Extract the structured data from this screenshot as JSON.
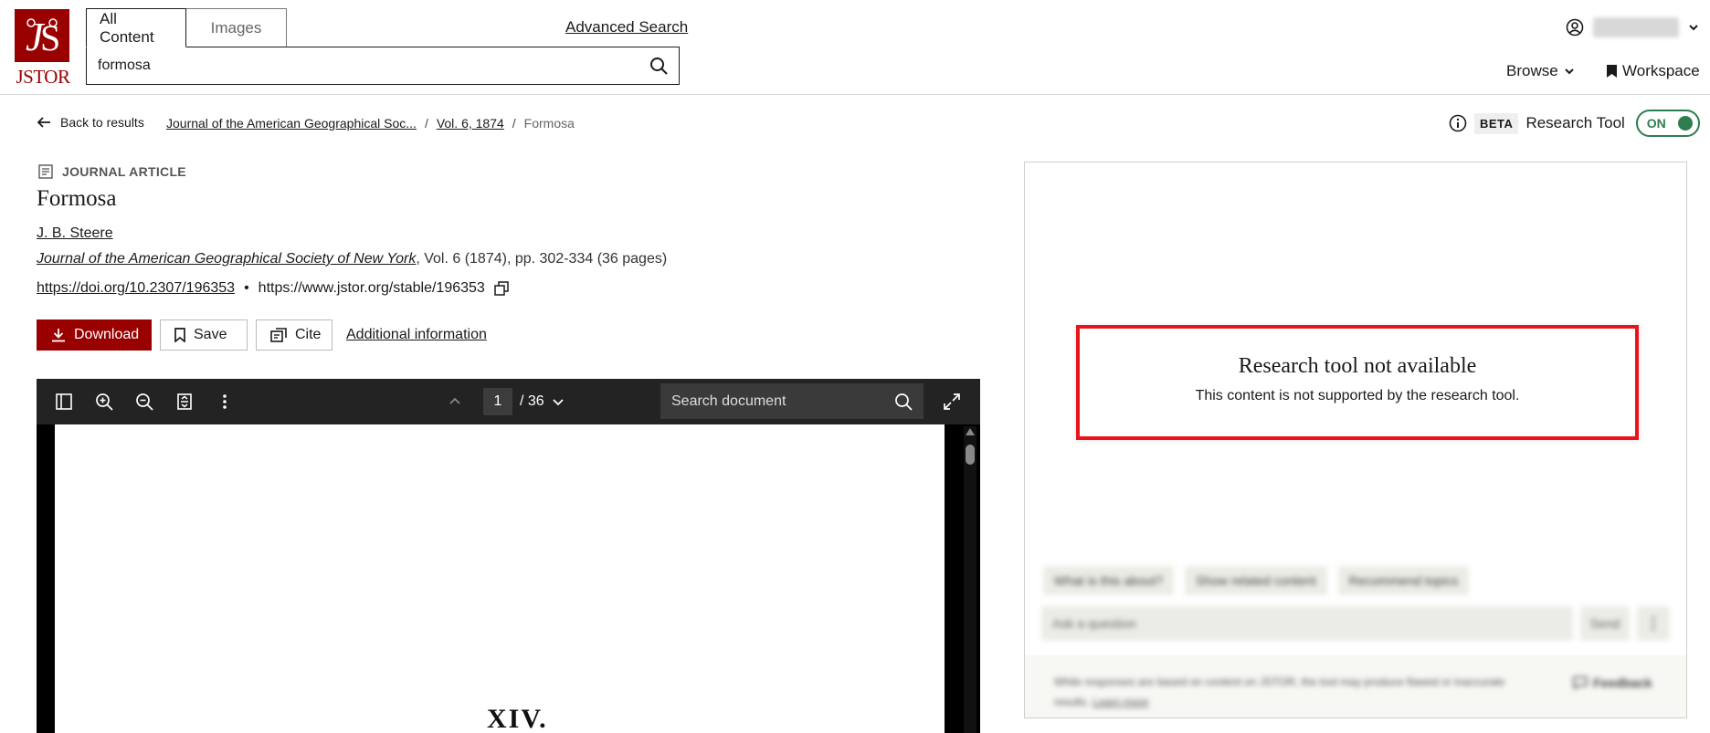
{
  "header": {
    "logo_text": "JSTOR",
    "tabs": [
      "All Content",
      "Images"
    ],
    "search_value": "formosa",
    "advanced_search": "Advanced Search",
    "browse": "Browse",
    "workspace": "Workspace"
  },
  "nav": {
    "back": "Back to results",
    "breadcrumbs": [
      "Journal of the American Geographical Soc...",
      "Vol. 6, 1874"
    ],
    "breadcrumb_current": "Formosa",
    "sep": "/"
  },
  "research_toggle": {
    "badge": "BETA",
    "label": "Research Tool",
    "state": "ON",
    "accent": "#2e7d4f"
  },
  "article": {
    "type": "JOURNAL ARTICLE",
    "title": "Formosa",
    "author": "J. B. Steere",
    "journal": "Journal of the American Geographical Society of New York",
    "journal_details": ", Vol. 6 (1874), pp. 302-334 (36 pages)",
    "doi": "https://doi.org/10.2307/196353",
    "bullet": "•",
    "stable_url": "https://www.jstor.org/stable/196353"
  },
  "actions": {
    "download": "Download",
    "save": "Save",
    "cite": "Cite",
    "additional_info": "Additional information",
    "brand_color": "#990000"
  },
  "viewer": {
    "page": "1",
    "total": "/ 36",
    "search_placeholder": "Search document",
    "page_heading": "XIV."
  },
  "research_panel": {
    "na_title": "Research tool not available",
    "na_message": "This content is not supported by the research tool.",
    "chips": [
      "What is this about?",
      "Show related content",
      "Recommend topics"
    ],
    "ask_placeholder": "Ask a question",
    "send": "Send",
    "disclaimer": "While responses are based on content on JSTOR, the tool may produce flawed or inaccurate results.",
    "learn_more": "Learn more",
    "feedback": "Feedback"
  }
}
